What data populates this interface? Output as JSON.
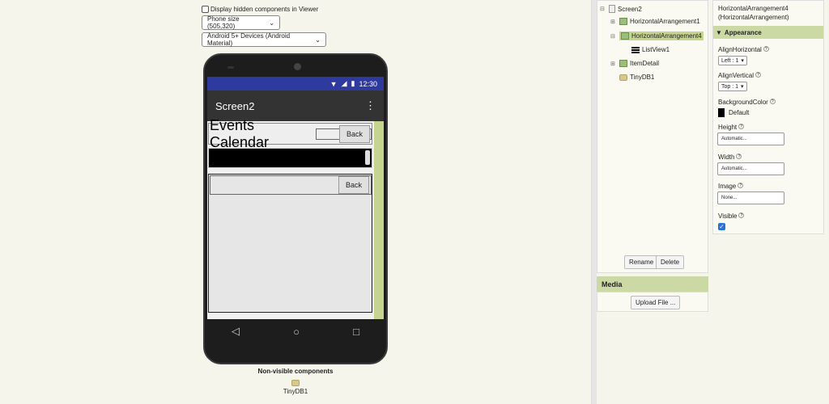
{
  "viewer": {
    "hidden_components_label": "Display hidden components in Viewer",
    "size_select": "Phone size (505,320)",
    "device_select": "Android 5+ Devices (Android Material)"
  },
  "phone": {
    "status_time": "12:30",
    "title": "Screen2",
    "menu_glyph": "⋮",
    "events_label": "Events Calendar",
    "back_label_1": "Back",
    "back_label_2": "Back",
    "nav": {
      "back": "◁",
      "home": "○",
      "recents": "□"
    }
  },
  "nonvisible": {
    "title": "Non-visible components",
    "items": [
      "TinyDB1"
    ]
  },
  "components": {
    "items": [
      {
        "label": "Screen2",
        "toggle": "⊟"
      },
      {
        "label": "HorizontalArrangement1",
        "toggle": "⊞"
      },
      {
        "label": "HorizontalArrangement4",
        "toggle": "⊟"
      },
      {
        "label": "ListView1",
        "toggle": ""
      },
      {
        "label": "ItemDetail",
        "toggle": "⊞"
      },
      {
        "label": "TinyDB1",
        "toggle": ""
      }
    ],
    "rename_label": "Rename",
    "delete_label": "Delete"
  },
  "media": {
    "title": "Media",
    "upload_label": "Upload File ..."
  },
  "properties": {
    "title_line1": "HorizontalArrangement4",
    "title_line2": "(HorizontalArrangement)",
    "section": "Appearance",
    "align_horizontal_label": "AlignHorizontal",
    "align_horizontal_value": "Left : 1",
    "align_vertical_label": "AlignVertical",
    "align_vertical_value": "Top : 1",
    "background_color_label": "BackgroundColor",
    "background_color_value": "Default",
    "height_label": "Height",
    "height_value": "Automatic...",
    "width_label": "Width",
    "width_value": "Automatic...",
    "image_label": "Image",
    "image_value": "None...",
    "visible_label": "Visible",
    "visible_checked": true
  },
  "colors": {
    "accent_green": "#cbd9a4",
    "status_bar": "#2f3a9e",
    "title_bar": "#333333"
  }
}
